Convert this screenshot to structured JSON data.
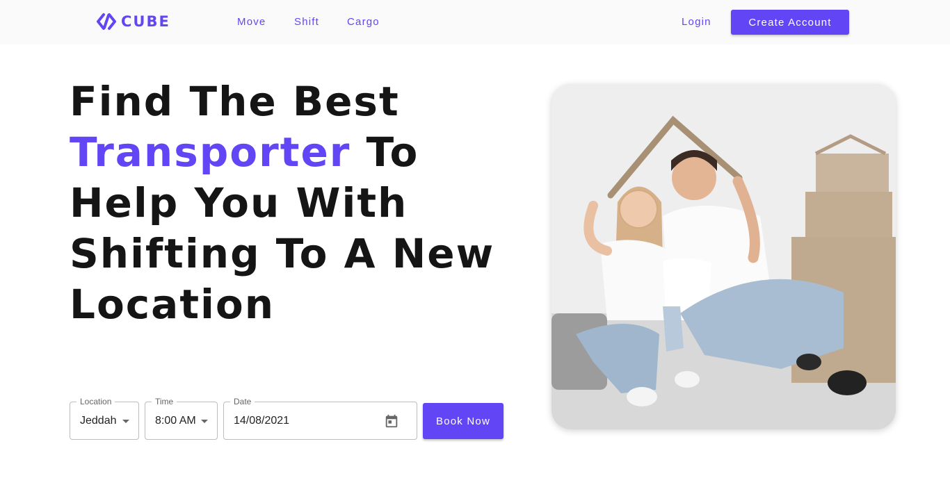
{
  "brand": {
    "name": "CUBE",
    "accent": "#6246f5"
  },
  "nav": {
    "links": [
      "Move",
      "Shift",
      "Cargo"
    ],
    "login": "Login",
    "create_account": "Create Account"
  },
  "hero": {
    "line1": "Find The Best",
    "accent_word": "Transporter",
    "line2_rest": " To",
    "line3": "Help You With",
    "line4": "Shifting To A New",
    "line5": "Location"
  },
  "booking": {
    "location": {
      "label": "Location",
      "value": "Jeddah",
      "icon": "chevron-down-icon"
    },
    "time": {
      "label": "Time",
      "value": "8:00 AM",
      "icon": "chevron-down-icon"
    },
    "date": {
      "label": "Date",
      "value": "14/08/2021",
      "icon": "calendar-icon"
    },
    "submit": "Book Now"
  }
}
